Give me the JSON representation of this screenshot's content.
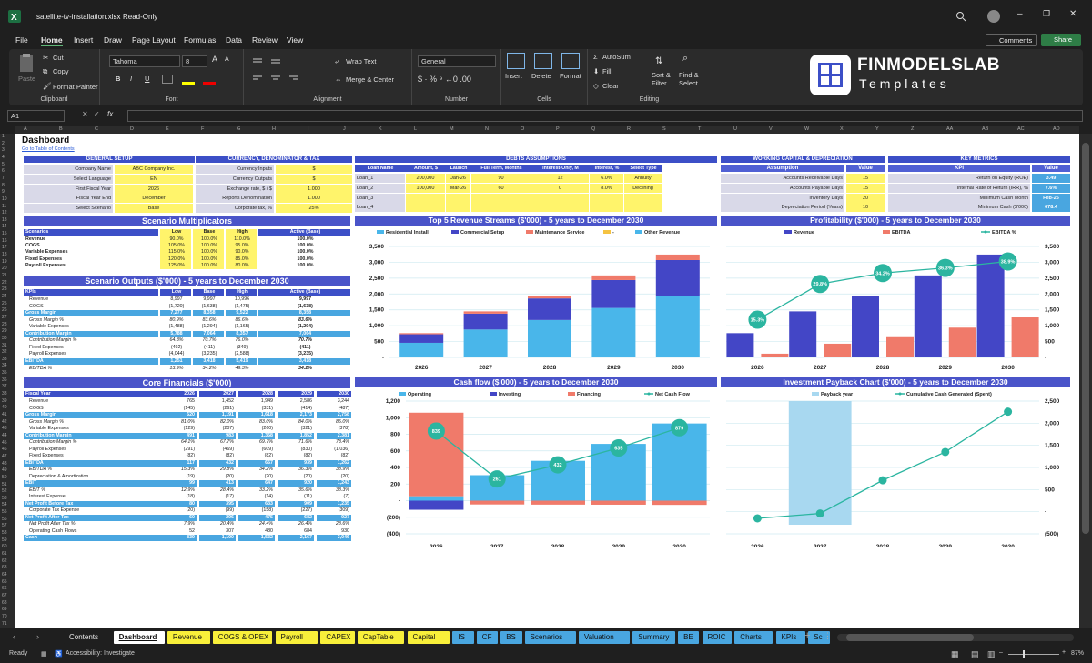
{
  "window": {
    "filename": "satellite-tv-installation.xlsx",
    "mode": "Read-Only"
  },
  "menu": [
    "File",
    "Home",
    "Insert",
    "Draw",
    "Page Layout",
    "Formulas",
    "Data",
    "Review",
    "View"
  ],
  "menu_right": {
    "comments": "Comments",
    "share": "Share"
  },
  "ribbon": {
    "clipboard": {
      "paste": "Paste",
      "cut": "Cut",
      "copy": "Copy",
      "format_painter": "Format Painter",
      "label": "Clipboard"
    },
    "font": {
      "name": "Tahoma",
      "size": "8",
      "label": "Font",
      "bold": "B",
      "italic": "I",
      "underline": "U",
      "grow": "A",
      "shrink": "A"
    },
    "alignment": {
      "wrap": "Wrap Text",
      "merge": "Merge & Center",
      "label": "Alignment"
    },
    "number": {
      "format": "General",
      "label": "Number"
    },
    "cells": {
      "insert": "Insert",
      "delete": "Delete",
      "format": "Format",
      "label": "Cells"
    },
    "editing": {
      "autosum": "AutoSum",
      "fill": "Fill",
      "clear": "Clear",
      "sort": "Sort & Filter",
      "find": "Find & Select",
      "label": "Editing"
    }
  },
  "logo": {
    "line1": "FINMODELSLAB",
    "line2": "Templates"
  },
  "formula_bar": {
    "cell": "A1",
    "fx": "fx"
  },
  "columns": [
    "A",
    "B",
    "C",
    "D",
    "E",
    "F",
    "G",
    "H",
    "I",
    "J",
    "K",
    "L",
    "M",
    "N",
    "O",
    "P",
    "Q",
    "R",
    "S",
    "T",
    "U",
    "V",
    "W",
    "X",
    "Y",
    "Z",
    "AA",
    "AB",
    "AC",
    "AD"
  ],
  "dashboard": {
    "title": "Dashboard",
    "link": "Go to Table of Contents",
    "general_setup": {
      "header": "GENERAL SETUP",
      "rows": [
        [
          "Company Name",
          "ABC Company Inc."
        ],
        [
          "Select Language",
          "EN"
        ],
        [
          "First Fiscal Year",
          "2026"
        ],
        [
          "Fiscal Year End",
          "December"
        ],
        [
          "Select Scenario",
          "Base"
        ]
      ]
    },
    "currency": {
      "header": "CURRENCY, DENOMINATOR & TAX",
      "rows": [
        [
          "Currency Inputs",
          "$"
        ],
        [
          "Currency Outputs",
          "$"
        ],
        [
          "Exchange rate, $ / $",
          "1.000"
        ],
        [
          "Reports Denomination",
          "1.000"
        ],
        [
          "Corporate tax, %",
          "25%"
        ]
      ]
    },
    "debts": {
      "header": "DEBTS ASSUMPTIONS",
      "cols": [
        "Loan Name",
        "Amount, $",
        "Launch",
        "Full Term, Months",
        "Interest-Only, M",
        "Interest, %",
        "Select Type"
      ],
      "rows": [
        [
          "Loan_1",
          "200,000",
          "Jan-26",
          "90",
          "12",
          "6.0%",
          "Annuity"
        ],
        [
          "Loan_2",
          "100,000",
          "Mar-26",
          "60",
          "0",
          "8.0%",
          "Declining Balance"
        ],
        [
          "Loan_3",
          "",
          "",
          "",
          "",
          "",
          ""
        ],
        [
          "Loan_4",
          "",
          "",
          "",
          "",
          "",
          ""
        ]
      ]
    },
    "working_capital": {
      "header": "WORKING CAPITAL & DEPRECIATION",
      "cols": [
        "Assumption",
        "Value"
      ],
      "rows": [
        [
          "Accounts Receivable Days",
          "15"
        ],
        [
          "Accounts Payable Days",
          "15"
        ],
        [
          "Inventory Days",
          "20"
        ],
        [
          "Depreciation Period (Years)",
          "10"
        ]
      ]
    },
    "key_metrics": {
      "header": "KEY METRICS",
      "cols": [
        "KPI",
        "Value"
      ],
      "rows": [
        [
          "Return on Equity (ROE)",
          "3.49"
        ],
        [
          "Internal Rate of Return (IRR), %",
          "7.6%"
        ],
        [
          "Minimum Cash Month",
          "Feb-26"
        ],
        [
          "Minimum Cash ($'000)",
          "678.4"
        ]
      ]
    },
    "scenario_multipliers": {
      "title": "Scenario Multiplicators",
      "cols": [
        "Scenarios",
        "Low",
        "Base",
        "High",
        "Active (Base)"
      ],
      "rows": [
        [
          "Revenue",
          "90.0%",
          "100.0%",
          "110.0%",
          "100.0%"
        ],
        [
          "COGS",
          "105.0%",
          "100.0%",
          "95.0%",
          "100.0%"
        ],
        [
          "Variable Expenses",
          "115.0%",
          "100.0%",
          "90.0%",
          "100.0%"
        ],
        [
          "Fixed Expenses",
          "120.0%",
          "100.0%",
          "85.0%",
          "100.0%"
        ],
        [
          "Payroll Expenses",
          "125.0%",
          "100.0%",
          "80.0%",
          "100.0%"
        ]
      ]
    },
    "scenario_outputs": {
      "title": "Scenario Outputs ($'000) - 5 years to December 2030",
      "cols": [
        "KPIs",
        "Low",
        "Base",
        "High",
        "Active (Base)"
      ],
      "rows": [
        [
          "Revenue",
          "8,997",
          "9,997",
          "10,996",
          "9,997",
          "n"
        ],
        [
          "COGS",
          "(1,720)",
          "(1,638)",
          "(1,475)",
          "(1,638)",
          "n"
        ],
        [
          "Gross Margin",
          "7,277",
          "8,358",
          "9,522",
          "8,358",
          "b"
        ],
        [
          "Gross Margin %",
          "80.9%",
          "83.6%",
          "86.6%",
          "83.6%",
          "i"
        ],
        [
          "Variable Expenses",
          "(1,488)",
          "(1,294)",
          "(1,165)",
          "(1,294)",
          "n"
        ],
        [
          "Contribution Margin",
          "5,788",
          "7,064",
          "8,357",
          "7,064",
          "b"
        ],
        [
          "Contribution Margin %",
          "64.3%",
          "70.7%",
          "76.0%",
          "70.7%",
          "i"
        ],
        [
          "Fixed Expenses",
          "(492)",
          "(411)",
          "(349)",
          "(411)",
          "n"
        ],
        [
          "Payroll Expenses",
          "(4,044)",
          "(3,235)",
          "(2,588)",
          "(3,235)",
          "n"
        ],
        [
          "EBITDA",
          "1,251",
          "3,418",
          "5,419",
          "3,418",
          "b"
        ],
        [
          "EBITDA %",
          "13.9%",
          "34.2%",
          "49.3%",
          "34.2%",
          "i"
        ]
      ]
    },
    "core_financials": {
      "title": "Core Financials ($'000)",
      "cols": [
        "Fiscal Year",
        "2026",
        "2027",
        "2028",
        "2029",
        "2030"
      ],
      "rows": [
        [
          "Revenue",
          "765",
          "1,452",
          "1,949",
          "2,586",
          "3,244",
          "n"
        ],
        [
          "COGS",
          "(145)",
          "(261)",
          "(331)",
          "(414)",
          "(487)",
          "n"
        ],
        [
          "Gross Margin",
          "620",
          "1,191",
          "1,618",
          "2,173",
          "2,758",
          "b"
        ],
        [
          "Gross Margin %",
          "81.0%",
          "82.0%",
          "83.0%",
          "84.0%",
          "85.0%",
          "i"
        ],
        [
          "Variable Expenses",
          "(129)",
          "(207)",
          "(260)",
          "(321)",
          "(378)",
          "n"
        ],
        [
          "Contribution Margin",
          "491",
          "983",
          "1,358",
          "1,852",
          "2,381",
          "b"
        ],
        [
          "Contribution Margin %",
          "64.1%",
          "67.7%",
          "69.7%",
          "71.6%",
          "73.4%",
          "i"
        ],
        [
          "Payroll Expenses",
          "(291)",
          "(469)",
          "(609)",
          "(830)",
          "(1,036)",
          "n"
        ],
        [
          "Fixed Expenses",
          "(82)",
          "(82)",
          "(82)",
          "(82)",
          "(82)",
          "n"
        ],
        [
          "EBITDA",
          "117",
          "432",
          "667",
          "939",
          "1,262",
          "b"
        ],
        [
          "EBITDA %",
          "15.3%",
          "29.8%",
          "34.2%",
          "36.3%",
          "38.9%",
          "i"
        ],
        [
          "Depreciation & Amortization",
          "(19)",
          "(20)",
          "(20)",
          "(20)",
          "(20)",
          "n"
        ],
        [
          "EBIT",
          "99",
          "413",
          "647",
          "920",
          "1,243",
          "b"
        ],
        [
          "EBIT %",
          "12.9%",
          "28.4%",
          "33.2%",
          "35.6%",
          "38.3%",
          "i"
        ],
        [
          "Interest Expense",
          "(18)",
          "(17)",
          "(14)",
          "(11)",
          "(7)",
          "n"
        ],
        [
          "Net Profit Before Tax",
          "80",
          "395",
          "633",
          "909",
          "1,235",
          "b"
        ],
        [
          "Corporate Tax Expense",
          "(20)",
          "(99)",
          "(158)",
          "(227)",
          "(309)",
          "n"
        ],
        [
          "Net Profit After Tax",
          "60",
          "296",
          "475",
          "682",
          "927",
          "b"
        ],
        [
          "Net Profit After Tax %",
          "7.9%",
          "20.4%",
          "24.4%",
          "26.4%",
          "28.6%",
          "i"
        ],
        [
          "Operating Cash Flows",
          "52",
          "307",
          "480",
          "684",
          "930",
          "n"
        ],
        [
          "Cash",
          "839",
          "1,100",
          "1,532",
          "2,167",
          "3,046",
          "b"
        ]
      ]
    }
  },
  "chart_data": [
    {
      "id": "revenue",
      "type": "bar",
      "title": "Top 5 Revenue Streams ($'000) - 5 years to December 2030",
      "categories": [
        "2026",
        "2027",
        "2028",
        "2029",
        "2030"
      ],
      "legend": [
        "Residential Install",
        "Commercial Setup",
        "Maintenance Service",
        "-",
        "Other Revenue"
      ],
      "series": [
        {
          "name": "Residential Install",
          "color": "#49b6ea",
          "values": [
            460,
            880,
            1180,
            1560,
            1940
          ]
        },
        {
          "name": "Commercial Setup",
          "color": "#4346c6",
          "values": [
            270,
            500,
            680,
            880,
            1130
          ]
        },
        {
          "name": "Maintenance Service",
          "color": "#f07a6a",
          "values": [
            35,
            72,
            89,
            146,
            174
          ]
        }
      ],
      "ylim": [
        0,
        3500
      ],
      "yticks": [
        "-",
        "500",
        "1,000",
        "1,500",
        "2,000",
        "2,500",
        "3,000",
        "3,500"
      ],
      "yside": "left"
    },
    {
      "id": "profitability",
      "type": "bar+line",
      "title": "Profitability ($'000) - 5 years to December 2030",
      "categories": [
        "2026",
        "2027",
        "2028",
        "2029",
        "2030"
      ],
      "legend": [
        "Revenue",
        "EBITDA",
        "EBITDA %"
      ],
      "revenue": [
        765,
        1452,
        1949,
        2586,
        3244
      ],
      "ebitda": [
        117,
        432,
        667,
        939,
        1262
      ],
      "ebitda_pct": [
        15.3,
        29.8,
        34.2,
        36.3,
        38.9
      ],
      "ebitda_pct_labels": [
        "15.3%",
        "29.8%",
        "34.2%",
        "36.3%",
        "38.9%"
      ],
      "ylim": [
        0,
        3500
      ],
      "yticks": [
        "-",
        "500",
        "1,000",
        "1,500",
        "2,000",
        "2,500",
        "3,000",
        "3,500"
      ],
      "yside": "right"
    },
    {
      "id": "cashflow",
      "type": "bar+line",
      "title": "Cash flow ($'000) - 5 years to December 2030",
      "categories": [
        "2026",
        "2027",
        "2028",
        "2029",
        "2030"
      ],
      "legend": [
        "Operating",
        "Investing",
        "Financing",
        "Net Cash Flow"
      ],
      "operating": [
        52,
        307,
        480,
        684,
        930
      ],
      "investing": [
        -110,
        0,
        0,
        0,
        0
      ],
      "financing": [
        1008,
        -46,
        -48,
        -49,
        -51
      ],
      "net": [
        839,
        261,
        432,
        635,
        879
      ],
      "ylim": [
        -400,
        1200
      ],
      "yticks": [
        "(400)",
        "(200)",
        "-",
        "200",
        "400",
        "600",
        "800",
        "1,000",
        "1,200"
      ],
      "yside": "left"
    },
    {
      "id": "payback",
      "type": "bar+line",
      "title": "Investment Payback Chart ($'000) - 5 years to December 2030",
      "categories": [
        "2026",
        "2027",
        "2028",
        "2029",
        "2030"
      ],
      "legend": [
        "Payback year",
        "Cumulative Cash Generated (Spent)"
      ],
      "payback_year": "2027",
      "cumulative": [
        -150,
        -40,
        710,
        1350,
        2260
      ],
      "ylim": [
        -500,
        2500
      ],
      "yticks": [
        "(500)",
        "-",
        "500",
        "1,000",
        "1,500",
        "2,000",
        "2,500"
      ],
      "yside": "right"
    }
  ],
  "tabs": [
    {
      "label": "Contents",
      "c": "#1f1f1f",
      "t": "#eee"
    },
    {
      "label": "Dashboard",
      "c": "#ffffff",
      "t": "#111"
    },
    {
      "label": "Revenue",
      "c": "#f8ef3a",
      "t": "#111"
    },
    {
      "label": "COGS & OPEX",
      "c": "#f8ef3a",
      "t": "#111"
    },
    {
      "label": "Payroll",
      "c": "#f8ef3a",
      "t": "#111"
    },
    {
      "label": "CAPEX",
      "c": "#f8ef3a",
      "t": "#111"
    },
    {
      "label": "CapTable",
      "c": "#f8ef3a",
      "t": "#111"
    },
    {
      "label": "Capital",
      "c": "#f8ef3a",
      "t": "#111"
    },
    {
      "label": "IS",
      "c": "#49a6e0",
      "t": "#111"
    },
    {
      "label": "CF",
      "c": "#49a6e0",
      "t": "#111"
    },
    {
      "label": "BS",
      "c": "#49a6e0",
      "t": "#111"
    },
    {
      "label": "Scenarios",
      "c": "#49a6e0",
      "t": "#111"
    },
    {
      "label": "Valuation",
      "c": "#49a6e0",
      "t": "#111"
    },
    {
      "label": "Summary",
      "c": "#49a6e0",
      "t": "#111"
    },
    {
      "label": "BE",
      "c": "#49a6e0",
      "t": "#111"
    },
    {
      "label": "ROIC",
      "c": "#49a6e0",
      "t": "#111"
    },
    {
      "label": "Charts",
      "c": "#49a6e0",
      "t": "#111"
    },
    {
      "label": "KPIs",
      "c": "#49a6e0",
      "t": "#111"
    },
    {
      "label": "Sc",
      "c": "#49a6e0",
      "t": "#111"
    }
  ],
  "status": {
    "ready": "Ready",
    "accessibility": "Accessibility: Investigate",
    "zoom": "87%"
  }
}
